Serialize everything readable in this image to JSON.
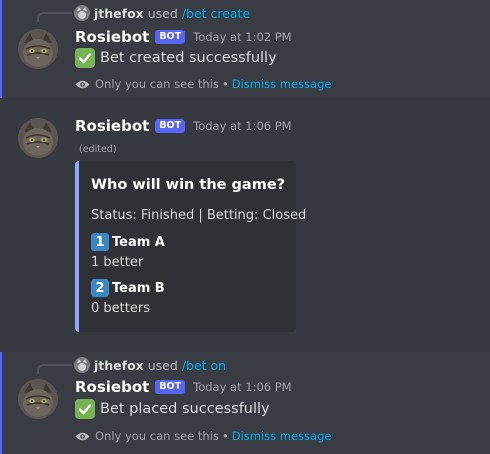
{
  "messages": [
    {
      "reply": {
        "user": "jthefox",
        "used": "used",
        "command": "/bet create"
      },
      "author": "Rosiebot",
      "bot_tag": "BOT",
      "timestamp": "Today at 1:02 PM",
      "content": "Bet created successfully",
      "ephemeral": {
        "note": "Only you can see this",
        "separator": "•",
        "dismiss": "Dismiss message"
      }
    },
    {
      "author": "Rosiebot",
      "bot_tag": "BOT",
      "timestamp": "Today at 1:06 PM",
      "edited": "(edited)",
      "embed": {
        "accent_color": "#8da7ff",
        "title": "Who will win the game?",
        "status": "Status: Finished | Betting: Closed",
        "fields": [
          {
            "number": "1",
            "name": "Team A",
            "value": "1 better"
          },
          {
            "number": "2",
            "name": "Team B",
            "value": "0 betters"
          }
        ]
      }
    },
    {
      "reply": {
        "user": "jthefox",
        "used": "used",
        "command": "/bet on"
      },
      "author": "Rosiebot",
      "bot_tag": "BOT",
      "timestamp": "Today at 1:06 PM",
      "content": "Bet placed successfully",
      "ephemeral": {
        "note": "Only you can see this",
        "separator": "•",
        "dismiss": "Dismiss message"
      }
    }
  ],
  "colors": {
    "background": "#36393f",
    "ephemeral_background": "#393c43",
    "link": "#00aff4",
    "bot_tag": "#5865f2",
    "check": "#77b255",
    "number_badge": "#3b88c3"
  },
  "icons": {
    "avatar": "cat-avatar",
    "success": "check-mark-icon",
    "visibility": "eye-icon"
  }
}
